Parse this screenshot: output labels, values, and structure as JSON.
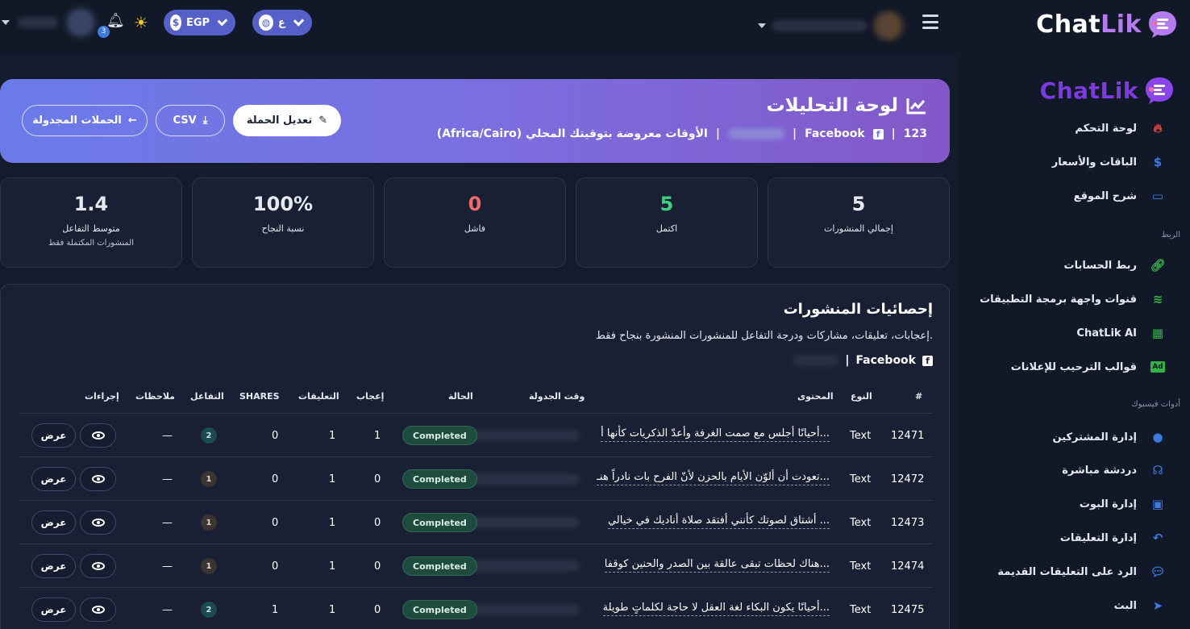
{
  "brand": {
    "name_part1": "Chat",
    "name_part2": "Lik",
    "accent": "#b47cf0"
  },
  "topbar": {
    "currency_label": "EGP",
    "language_label": "ع",
    "notification_count": "3"
  },
  "sidebar": {
    "items_main": [
      {
        "label": "لوحة التحكم",
        "icon": "fire-icon",
        "color": "#e0433d"
      },
      {
        "label": "الباقات والأسعار",
        "icon": "dollar-icon",
        "color": "#3d7be0"
      },
      {
        "label": "شرح الموقع",
        "icon": "presentation-icon",
        "color": "#3d7be0"
      }
    ],
    "section_link": "الربط",
    "items_link": [
      {
        "label": "ربط الحسابات",
        "icon": "link-icon",
        "color": "#35b34a"
      },
      {
        "label": "قنوات واجهة برمجة التطبيقات",
        "icon": "wifi-icon",
        "color": "#35b34a"
      },
      {
        "label": "ChatLik AI",
        "icon": "chip-icon",
        "color": "#35b34a"
      },
      {
        "label": "قوالب الترحيب للإعلانات",
        "icon": "ad-icon",
        "color": "#35b34a"
      }
    ],
    "section_tools": "أدوات فيسبوك",
    "items_tools": [
      {
        "label": "إدارة المشتركين",
        "icon": "user-circle-icon",
        "color": "#3d7be0"
      },
      {
        "label": "دردشة مباشرة",
        "icon": "headset-icon",
        "color": "#3d7be0"
      },
      {
        "label": "إدارة البوت",
        "icon": "robot-icon",
        "color": "#3d7be0"
      },
      {
        "label": "إدارة التعليقات",
        "icon": "reply-all-icon",
        "color": "#3d7be0"
      },
      {
        "label": "الرد على التعليقات القديمة",
        "icon": "comment-dots-icon",
        "color": "#3d7be0"
      },
      {
        "label": "البث",
        "icon": "paper-plane-icon",
        "color": "#3d7be0"
      }
    ]
  },
  "hero": {
    "title": "لوحة التحليلات",
    "campaign_id": "123",
    "platform": "Facebook",
    "timezone_note": "الأوقات معروضة بتوقيتك المحلي (Africa/Cairo)",
    "btn_edit": "تعديل الحملة",
    "btn_csv": "CSV",
    "btn_back": "الحملات المجدولة"
  },
  "stats": [
    {
      "value": "5",
      "label": "إجمالي المنشورات",
      "sub": "",
      "color": "#ffffff"
    },
    {
      "value": "5",
      "label": "اكتمل",
      "sub": "",
      "color": "#3fd07f"
    },
    {
      "value": "0",
      "label": "فاشل",
      "sub": "",
      "color": "#ef6b6b"
    },
    {
      "value": "100%",
      "label": "نسبة النجاح",
      "sub": "",
      "color": "#ffffff"
    },
    {
      "value": "1.4",
      "label": "متوسط التفاعل",
      "sub": "المنشورات المكتملة فقط",
      "color": "#ffffff"
    }
  ],
  "panel": {
    "title": "إحصائيات المنشورات",
    "desc": "إعجابات، تعليقات، مشاركات ودرجة التفاعل للمنشورات المنشورة بنجاح فقط.",
    "platform": "Facebook"
  },
  "table": {
    "headers": {
      "num": "#",
      "type": "النوع",
      "content": "المحتوى",
      "time": "وقت الجدولة",
      "status": "الحالة",
      "likes": "إعجاب",
      "comments": "التعليقات",
      "shares": "SHARES",
      "engagement": "التفاعل",
      "notes": "ملاحظات",
      "actions": "إجراءات"
    },
    "rows": [
      {
        "id": "12471",
        "type": "Text",
        "content": "أحيانًا أجلس مع صمت الغرفة وأعدّ الذكريات كأنها أ...",
        "status": "Completed",
        "likes": "1",
        "comments": "1",
        "shares": "0",
        "engagement": "2",
        "notes": "—",
        "view": "عرض"
      },
      {
        "id": "12472",
        "type": "Text",
        "content": "تعودت أن ألوّن الأيام بالحزن لأنّ الفرح بات نادراً هنـ...",
        "status": "Completed",
        "likes": "0",
        "comments": "1",
        "shares": "0",
        "engagement": "1",
        "notes": "—",
        "view": "عرض"
      },
      {
        "id": "12473",
        "type": "Text",
        "content": "أشتاق لصوتك كأنني أفتقد صلاة أناديك في خيالي ...",
        "status": "Completed",
        "likes": "0",
        "comments": "1",
        "shares": "0",
        "engagement": "1",
        "notes": "—",
        "view": "عرض"
      },
      {
        "id": "12474",
        "type": "Text",
        "content": "هناك لحظات تبقى عالقة بين الصدر والحنين كوقفا...",
        "status": "Completed",
        "likes": "0",
        "comments": "1",
        "shares": "0",
        "engagement": "1",
        "notes": "—",
        "view": "عرض"
      },
      {
        "id": "12475",
        "type": "Text",
        "content": "أحيانًا يكون البكاء لغة العقل لا حاجة لكلماتٍ طويلة...",
        "status": "Completed",
        "likes": "0",
        "comments": "1",
        "shares": "1",
        "engagement": "2",
        "notes": "—",
        "view": "عرض"
      }
    ]
  }
}
